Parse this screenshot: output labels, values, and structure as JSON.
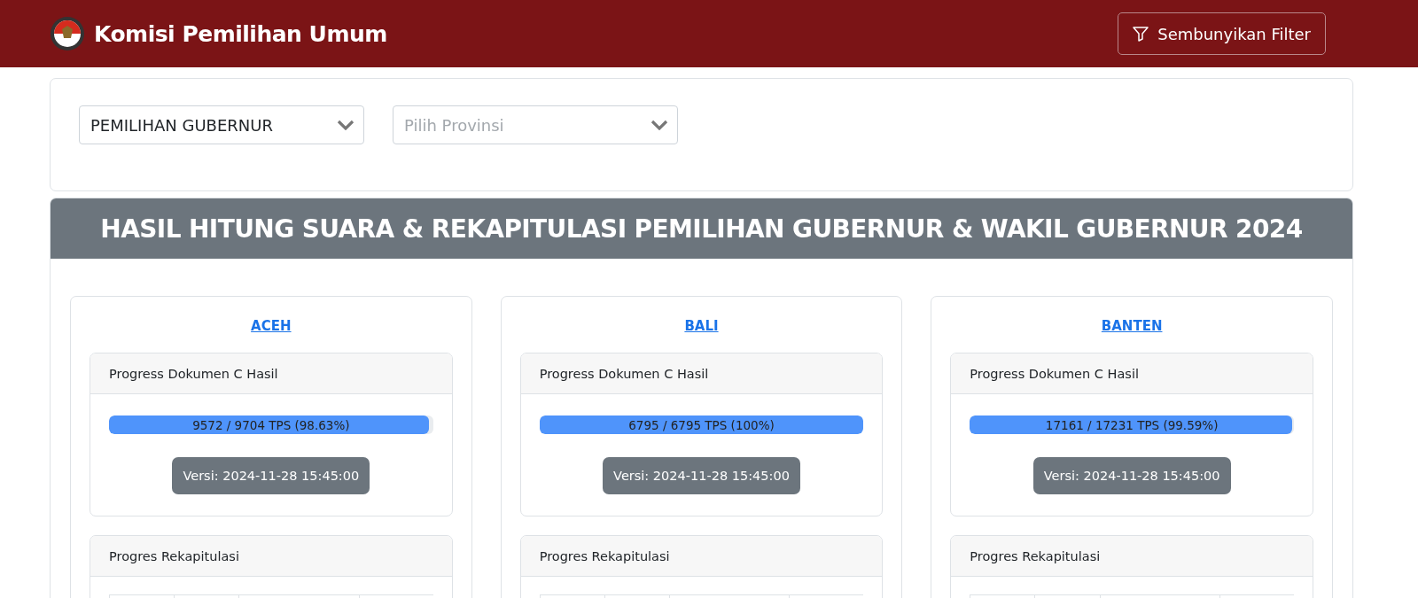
{
  "header": {
    "title": "Komisi Pemilihan Umum",
    "filter_button": "Sembunyikan Filter"
  },
  "filters": [
    {
      "kind": "value",
      "text": "PEMILIHAN GUBERNUR"
    },
    {
      "kind": "placeholder",
      "text": "Pilih Provinsi"
    }
  ],
  "title": "HASIL HITUNG SUARA & REKAPITULASI PEMILIHAN GUBERNUR & WAKIL GUBERNUR 2024",
  "provinces": [
    {
      "name": "ACEH",
      "progress_title": "Progress Dokumen C Hasil",
      "level": 0.9863,
      "reading": "9572 / 9704 TPS (98.63%)",
      "version": "Versi: 2024-11-28 15:45:00",
      "recap_title": "Progres Rekapitulasi"
    },
    {
      "name": "BALI",
      "progress_title": "Progress Dokumen C Hasil",
      "level": 1,
      "reading": "6795 / 6795 TPS (100%)",
      "version": "Versi: 2024-11-28 15:45:00",
      "recap_title": "Progres Rekapitulasi"
    },
    {
      "name": "BANTEN",
      "progress_title": "Progress Dokumen C Hasil",
      "level": 0.9959,
      "reading": "17161 / 17231 TPS (99.59%)",
      "version": "Versi: 2024-11-28 15:45:00",
      "recap_title": "Progres Rekapitulasi"
    }
  ]
}
